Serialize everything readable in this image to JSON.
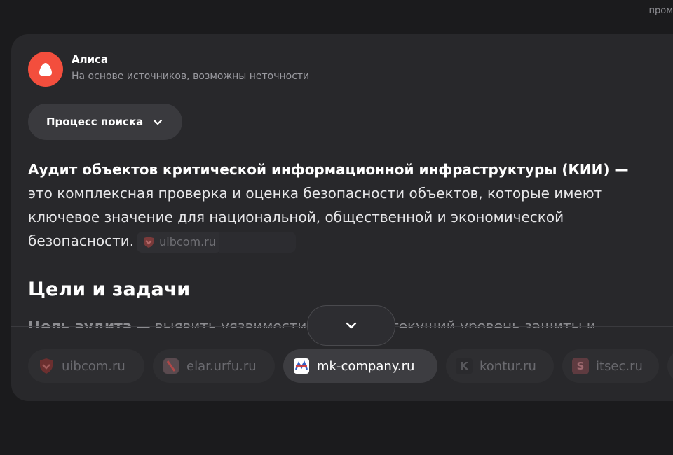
{
  "top": {
    "clipped_text": "пром"
  },
  "author": {
    "name": "Алиса",
    "subtitle": "На основе источников, возможны неточности"
  },
  "process_button": {
    "label": "Процесс поиска",
    "icon": "chevron-down-icon"
  },
  "answer": {
    "bold_lead": "Аудит объектов критической информационной инфраструктуры (КИИ)",
    "dash": " —",
    "line1_rest": "это комплексная проверка и оценка безопасности объектов, которые имеют",
    "line2": "ключевое значение для национальной, общественной и экономической",
    "line3": "безопасности.",
    "inline_source": "uibcom.ru"
  },
  "section": {
    "heading": "Цели и задачи",
    "partial_bold": "Цель аудита",
    "partial_rest": " — выявить уязвимости и оценить текущий уровень защиты и"
  },
  "sources": [
    {
      "label": "uibcom.ru",
      "icon": "uibcom-shield-icon",
      "active": false
    },
    {
      "label": "elar.urfu.ru",
      "icon": "elar-logo-icon",
      "active": false
    },
    {
      "label": "mk-company.ru",
      "icon": "mk-company-logo-icon",
      "active": true
    },
    {
      "label": "kontur.ru",
      "icon": "kontur-k-icon",
      "active": false
    },
    {
      "label": "itsec.ru",
      "icon": "itsec-s-icon",
      "active": false
    }
  ],
  "colors": {
    "accent": "#f34e3d",
    "card": "#28282b",
    "background": "#1b1b1d"
  }
}
